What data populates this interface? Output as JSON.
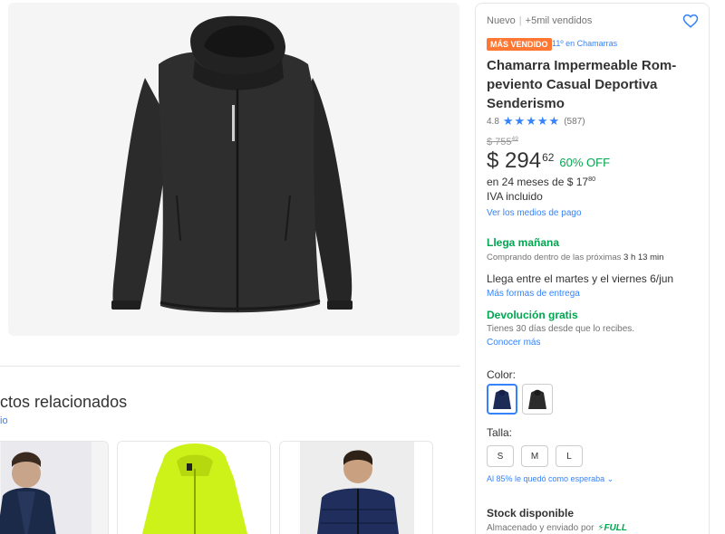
{
  "gallery": {
    "main_image": "black rain jacket"
  },
  "related": {
    "title": "ctos relacionados",
    "link": "io",
    "cards": [
      {
        "image": "man in navy hooded jacket"
      },
      {
        "image": "neon yellow rain jacket"
      },
      {
        "image": "man in navy puffer jacket"
      }
    ]
  },
  "buybox": {
    "condition": "Nuevo",
    "sold": "+5mil vendidos",
    "badge": "MÁS VENDIDO",
    "rank": "11º en Chamarras",
    "title": "Chamarra Impermeable Rom-peviento Casual Deportiva Senderismo",
    "rating": "4.8",
    "stars": "★★★★★",
    "reviews": "(587)",
    "old_price": "$ 755",
    "old_price_cents": "49",
    "price": "$ 294",
    "price_cents": "62",
    "discount": "60% OFF",
    "installments_prefix": "en 24 meses de $ 17",
    "installments_cents": "80",
    "iva": "IVA incluido",
    "payment_link": "Ver los medios de pago",
    "arrive_title": "Llega mañana",
    "arrive_sub_prefix": "Comprando dentro de las próximas",
    "arrive_sub_time": "3 h 13 min",
    "arrive2": "Llega entre el martes y el viernes 6/jun",
    "more_shipping": "Más formas de entrega",
    "return_title": "Devolución gratis",
    "return_sub": "Tienes 30 días desde que lo recibes.",
    "return_link": "Conocer más",
    "color_label": "Color:",
    "colors": [
      "navy",
      "black"
    ],
    "size_label": "Talla:",
    "sizes": [
      "S",
      "M",
      "L"
    ],
    "fit_text": "Al 85% le quedó como esperaba",
    "stock_title": "Stock disponible",
    "stored_text": "Almacenado y enviado por",
    "full_label": "FULL"
  },
  "colors": {
    "accent": "#3483fa",
    "green": "#00a650",
    "badge": "#ff7733"
  }
}
